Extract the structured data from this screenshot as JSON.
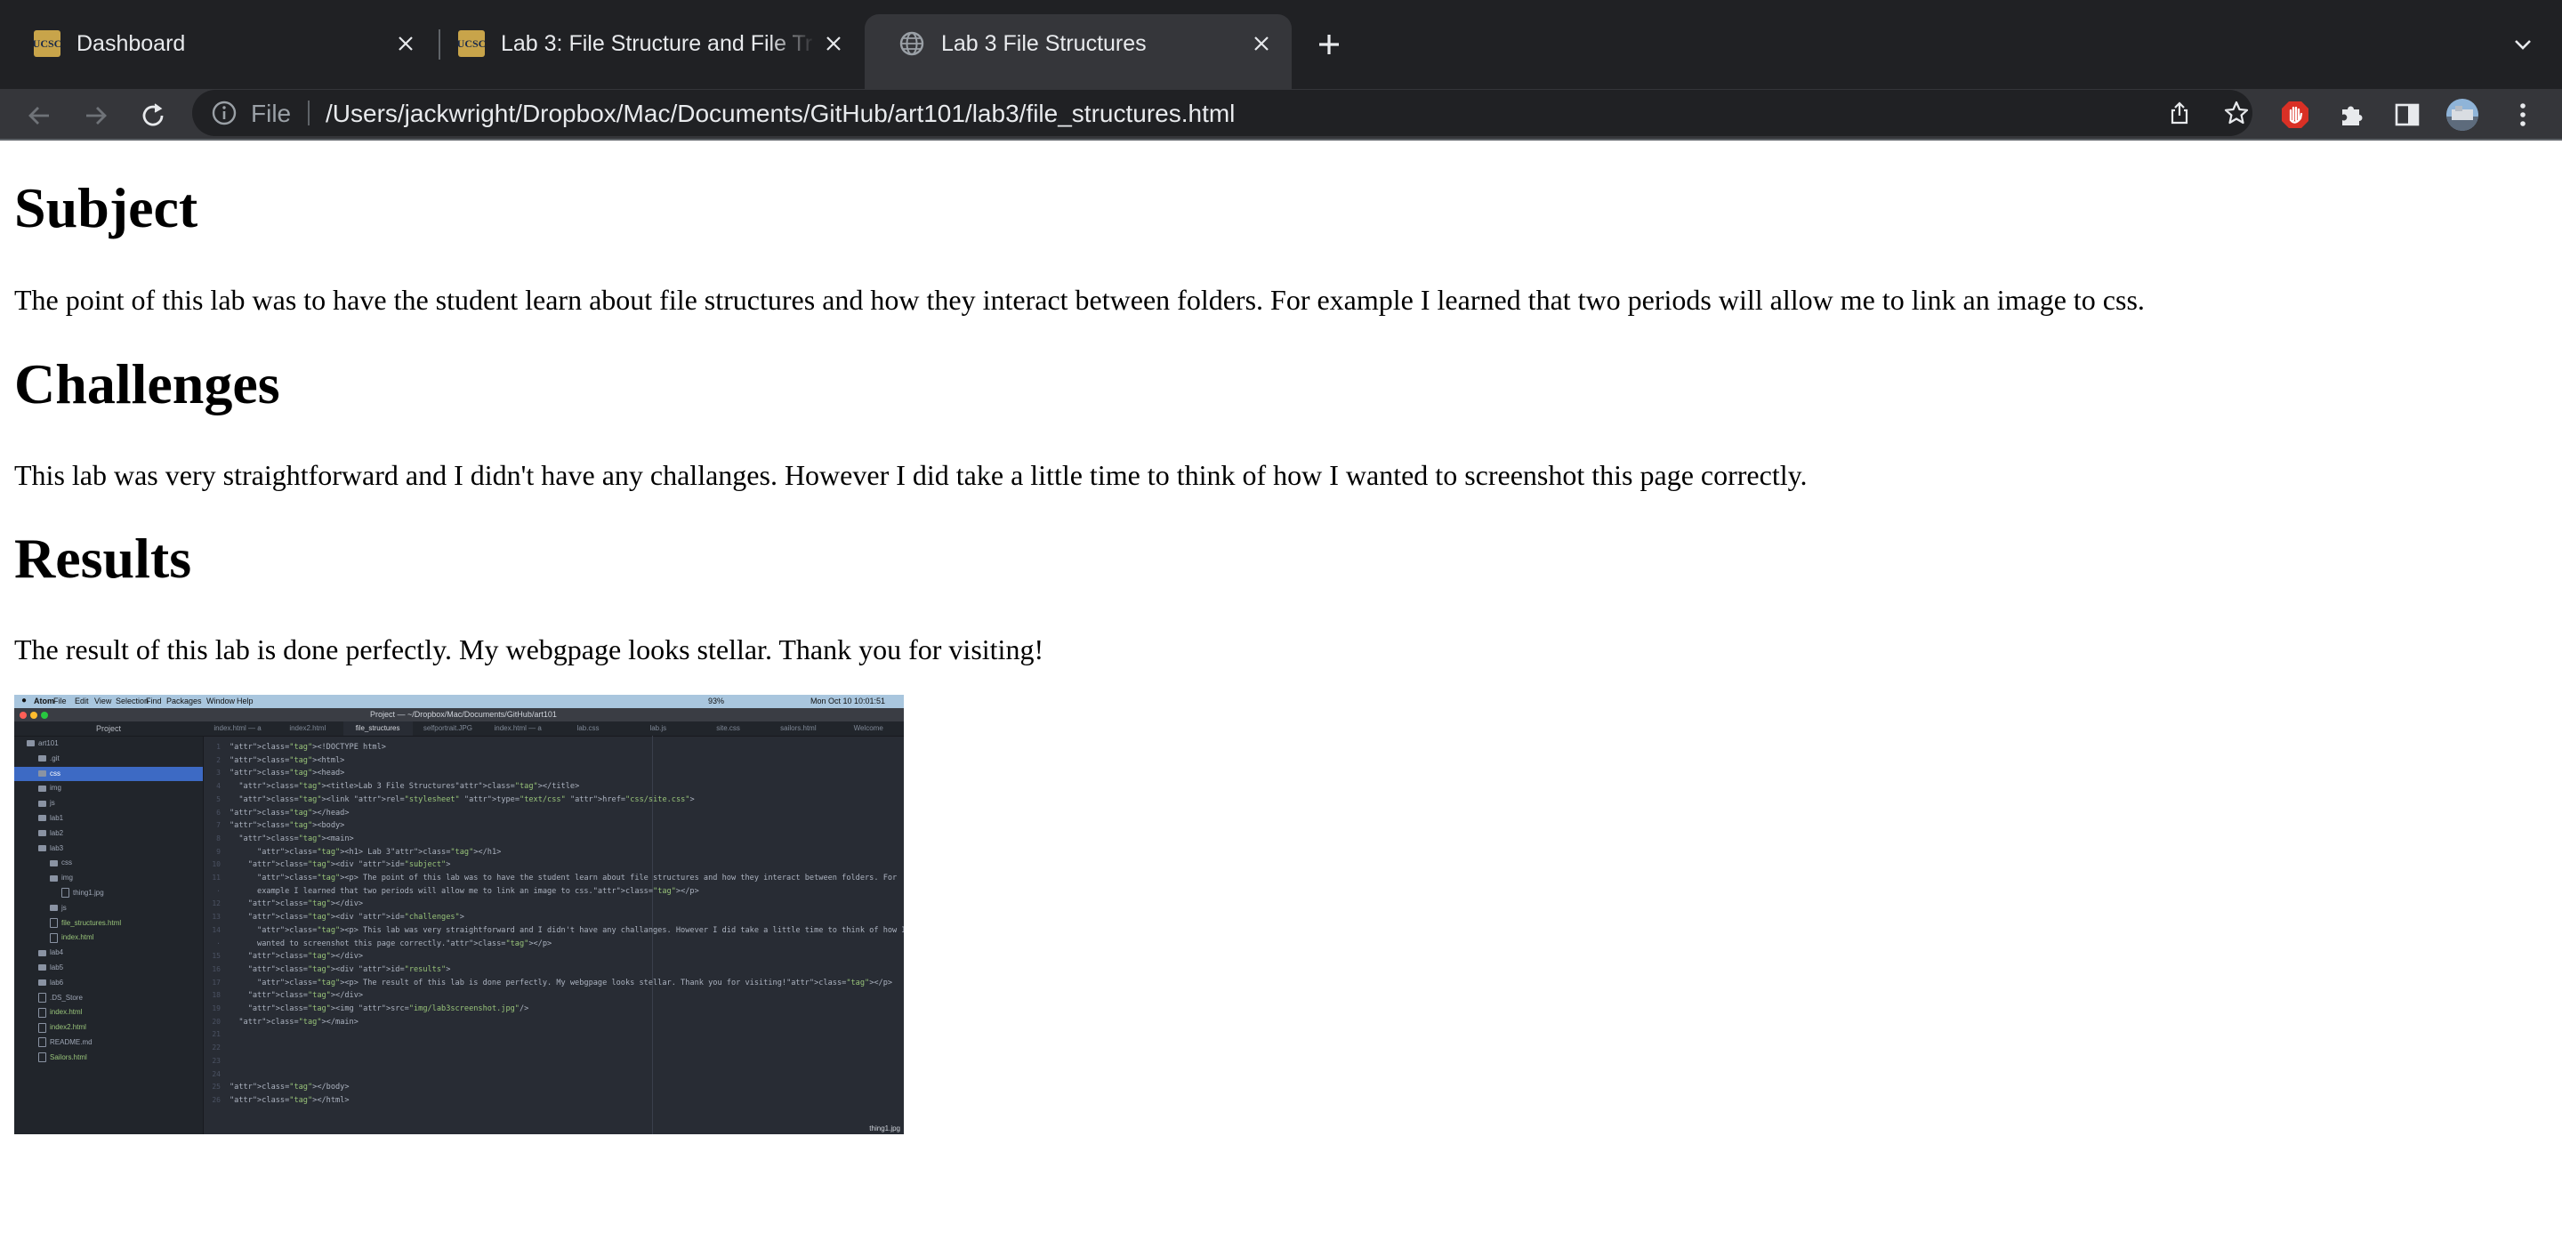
{
  "browser": {
    "tabs": [
      {
        "title": "Dashboard",
        "favicon": "ucsc-logo-icon",
        "active": false
      },
      {
        "title": "Lab 3: File Structure and File Tr",
        "favicon": "ucsc-logo-icon",
        "active": false
      },
      {
        "title": "Lab 3 File Structures",
        "favicon": "globe-icon",
        "active": true
      }
    ],
    "favicon_text": "UCSC",
    "address": {
      "scheme_label": "File",
      "url": "/Users/jackwright/Dropbox/Mac/Documents/GitHub/art101/lab3/file_structures.html"
    },
    "colors": {
      "tabstrip": "#202124",
      "toolbar": "#35363a",
      "omnibox": "#202124",
      "text": "#e8eaed",
      "extension_red": "#d93025"
    }
  },
  "page": {
    "subject_heading": "Subject",
    "subject_text": "The point of this lab was to have the student learn about file structures and how they interact between folders. For example I learned that two periods will allow me to link an image to css.",
    "challenges_heading": "Challenges",
    "challenges_text": "This lab was very straightforward and I didn't have any challanges. However I did take a little time to think of how I wanted to screenshot this page correctly.",
    "results_heading": "Results",
    "results_text": "The result of this lab is done perfectly. My webgpage looks stellar. Thank you for visiting!"
  },
  "screenshot": {
    "menubar": [
      "Atom",
      "File",
      "Edit",
      "View",
      "Selection",
      "Find",
      "Packages",
      "Window",
      "Help"
    ],
    "clock": "Mon Oct 10  10:01:51",
    "battery": "93%",
    "window_title": "Project — ~/Dropbox/Mac/Documents/GitHub/art101",
    "tree_header": "Project",
    "tree": [
      {
        "label": "art101",
        "depth": 0,
        "kind": "folder"
      },
      {
        "label": ".git",
        "depth": 1,
        "kind": "folder"
      },
      {
        "label": "css",
        "depth": 1,
        "kind": "folder",
        "selected": true
      },
      {
        "label": "img",
        "depth": 1,
        "kind": "folder"
      },
      {
        "label": "js",
        "depth": 1,
        "kind": "folder"
      },
      {
        "label": "lab1",
        "depth": 1,
        "kind": "folder"
      },
      {
        "label": "lab2",
        "depth": 1,
        "kind": "folder"
      },
      {
        "label": "lab3",
        "depth": 1,
        "kind": "folder"
      },
      {
        "label": "css",
        "depth": 2,
        "kind": "folder"
      },
      {
        "label": "img",
        "depth": 2,
        "kind": "folder"
      },
      {
        "label": "thing1.jpg",
        "depth": 3,
        "kind": "file"
      },
      {
        "label": "js",
        "depth": 2,
        "kind": "folder"
      },
      {
        "label": "file_structures.html",
        "depth": 2,
        "kind": "file"
      },
      {
        "label": "index.html",
        "depth": 2,
        "kind": "file"
      },
      {
        "label": "lab4",
        "depth": 1,
        "kind": "folder"
      },
      {
        "label": "lab5",
        "depth": 1,
        "kind": "folder"
      },
      {
        "label": "lab6",
        "depth": 1,
        "kind": "folder"
      },
      {
        "label": ".DS_Store",
        "depth": 1,
        "kind": "file"
      },
      {
        "label": "index.html",
        "depth": 1,
        "kind": "file"
      },
      {
        "label": "index2.html",
        "depth": 1,
        "kind": "file"
      },
      {
        "label": "README.md",
        "depth": 1,
        "kind": "file"
      },
      {
        "label": "Sailors.html",
        "depth": 1,
        "kind": "file"
      }
    ],
    "editor_tabs": [
      {
        "label": "index.html — a",
        "active": false
      },
      {
        "label": "index2.html",
        "active": false
      },
      {
        "label": "file_structures",
        "active": true
      },
      {
        "label": "selfportrait.JPG",
        "active": false
      },
      {
        "label": "index.html — a",
        "active": false
      },
      {
        "label": "lab.css",
        "active": false
      },
      {
        "label": "lab.js",
        "active": false
      },
      {
        "label": "site.css",
        "active": false
      },
      {
        "label": "sailors.html",
        "active": false
      },
      {
        "label": "Welcome",
        "active": false
      }
    ],
    "code": [
      "<!DOCTYPE html>",
      "<html>",
      "<head>",
      "  <title>Lab 3 File Structures</title>",
      "  <link rel=\"stylesheet\" type=\"text/css\" href=\"css/site.css\">",
      "</head>",
      "<body>",
      "  <main>",
      "      <h1> Lab 3</h1>",
      "    <div id=\"subject\">",
      "      <p> The point of this lab was to have the student learn about file structures and how they interact between folders. For",
      "      example I learned that two periods will allow me to link an image to css.</p>",
      "    </div>",
      "    <div id=\"challenges\">",
      "      <p> This lab was very straightforward and I didn't have any challanges. However I did take a little time to think of how I",
      "      wanted to screenshot this page correctly.</p>",
      "    </div>",
      "    <div id=\"results\">",
      "      <p> The result of this lab is done perfectly. My webgpage looks stellar. Thank you for visiting!</p>",
      "    </div>",
      "    <img src=\"img/lab3screenshot.jpg\"/>",
      "  </main>",
      "",
      "",
      "",
      "",
      "</body>",
      "</html>"
    ],
    "line_numbers": [
      "1",
      "2",
      "3",
      "4",
      "5",
      "6",
      "7",
      "8",
      "9",
      "10",
      "11",
      "·",
      "12",
      "13",
      "14",
      "·",
      "15",
      "16",
      "17",
      "18",
      "19",
      "20",
      "21",
      "22",
      "23",
      "24",
      "25",
      "26"
    ],
    "status_file": "thing1.jpg"
  }
}
